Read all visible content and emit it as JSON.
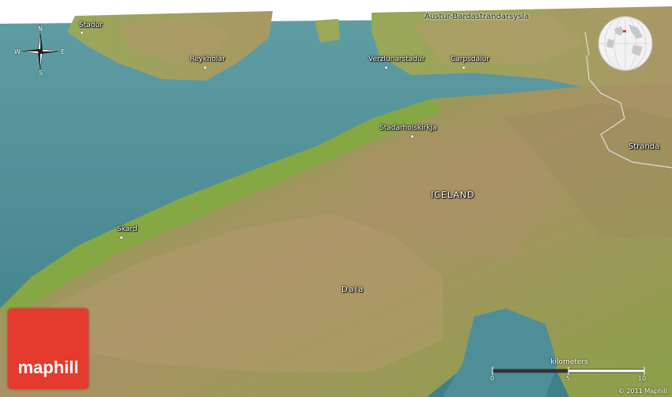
{
  "map": {
    "places": [
      {
        "id": "stadur",
        "label": "Stadur"
      },
      {
        "id": "reykholar",
        "label": "Reykholar"
      },
      {
        "id": "austur",
        "label": "Austur-Bardastrandarsysla"
      },
      {
        "id": "verzlunarstadur",
        "label": "Verzlunarstadur"
      },
      {
        "id": "carpsdalur",
        "label": "Carpsdalur"
      },
      {
        "id": "stadarholskirkja",
        "label": "Stadarholskirkja"
      },
      {
        "id": "strandа",
        "label": "Stranda"
      },
      {
        "id": "iceland",
        "label": "ICELAND"
      },
      {
        "id": "skard",
        "label": "Skard"
      },
      {
        "id": "dala",
        "label": "Dala"
      }
    ],
    "colors": {
      "water": "#4f8f98",
      "lowland": "#8fae4a",
      "highland": "#a38f62",
      "logo": "#e53a2e"
    }
  },
  "compass": {
    "n": "N",
    "s": "S",
    "e": "E",
    "w": "W"
  },
  "logo": {
    "text": "maphill"
  },
  "scale": {
    "title": "kilometers",
    "ticks": [
      "0",
      "5",
      "10"
    ]
  },
  "copyright": "© 2011 Maphill"
}
